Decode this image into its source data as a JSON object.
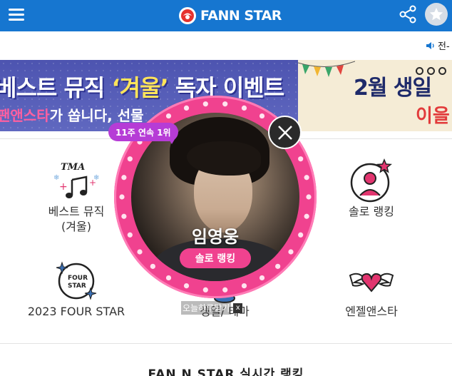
{
  "header": {
    "brand": "FANN STAR",
    "brand_color": "#1676d0",
    "icons": [
      "menu-icon",
      "logo-mark-icon",
      "share-icon",
      "star-icon"
    ]
  },
  "notice": {
    "text": "전-"
  },
  "banner": {
    "left_title_a": "베스트 뮤직 ",
    "left_title_quote": "‘겨울’",
    "left_title_b": " 독자 이벤트",
    "left_sub_a": "팬앤스타",
    "left_sub_b": "가 쏩니다, 선물",
    "right_title": "2월 생일",
    "right_sub": "이을"
  },
  "menu": {
    "items": [
      {
        "key": "best-music",
        "label_line1": "베스트 뮤직",
        "label_line2": "(겨울)",
        "icon": "tma-music-icon"
      },
      {
        "key": "solo-ranking",
        "label_line1": "솔로 랭킹",
        "label_line2": "",
        "icon": "person-star-icon"
      },
      {
        "key": "four-star",
        "label_line1": "2023 FOUR STAR",
        "label_line2": "",
        "icon": "four-star-icon"
      },
      {
        "key": "birthday-theme",
        "label_line1": "생일/ 테마",
        "label_line2": "",
        "icon": "cake-icon"
      },
      {
        "key": "angel-star",
        "label_line1": "엔젤앤스타",
        "label_line2": "",
        "icon": "winged-heart-icon"
      }
    ]
  },
  "ranking": {
    "title": "FAN N STAR 실시간 랭킹"
  },
  "popup": {
    "streak_badge": "11주 연속 1위",
    "artist_name": "임영웅",
    "cta": "솔로 랭킹",
    "dismiss_text": "오늘하루닫기",
    "dismiss_x": "x",
    "accent_color": "#f0428f",
    "badge_color": "#b63cd6"
  }
}
